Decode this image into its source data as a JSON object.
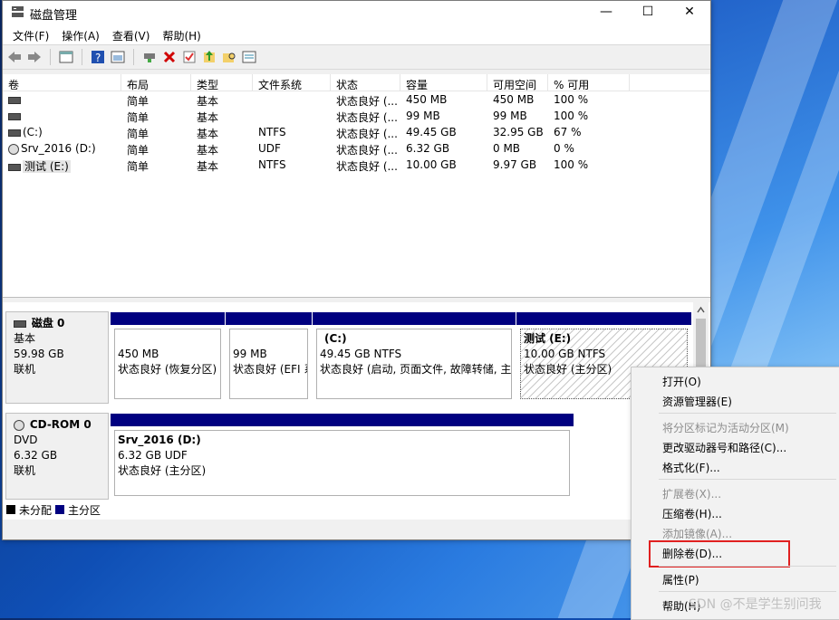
{
  "window": {
    "title": "磁盘管理",
    "min": "—",
    "max": "☐",
    "close": "✕"
  },
  "menu": [
    "文件(F)",
    "操作(A)",
    "查看(V)",
    "帮助(H)"
  ],
  "columns": [
    "卷",
    "布局",
    "类型",
    "文件系统",
    "状态",
    "容量",
    "可用空间",
    "% 可用"
  ],
  "volumes": [
    {
      "icon": "drive",
      "name": "",
      "layout": "简单",
      "type": "基本",
      "fs": "",
      "status": "状态良好 (...",
      "capacity": "450 MB",
      "free": "450 MB",
      "pct": "100 %"
    },
    {
      "icon": "drive",
      "name": "",
      "layout": "简单",
      "type": "基本",
      "fs": "",
      "status": "状态良好 (...",
      "capacity": "99 MB",
      "free": "99 MB",
      "pct": "100 %"
    },
    {
      "icon": "drive",
      "name": "(C:)",
      "layout": "简单",
      "type": "基本",
      "fs": "NTFS",
      "status": "状态良好 (...",
      "capacity": "49.45 GB",
      "free": "32.95 GB",
      "pct": "67 %"
    },
    {
      "icon": "cd",
      "name": "Srv_2016 (D:)",
      "layout": "简单",
      "type": "基本",
      "fs": "UDF",
      "status": "状态良好 (...",
      "capacity": "6.32 GB",
      "free": "0 MB",
      "pct": "0 %"
    },
    {
      "icon": "drive",
      "name": "测试 (E:)",
      "layout": "简单",
      "type": "基本",
      "fs": "NTFS",
      "status": "状态良好 (...",
      "capacity": "10.00 GB",
      "free": "9.97 GB",
      "pct": "100 %"
    }
  ],
  "disk0": {
    "name": "磁盘 0",
    "type": "基本",
    "size": "59.98 GB",
    "state": "联机",
    "partitions": [
      {
        "title": "",
        "size": "450 MB",
        "status": "状态良好 (恢复分区)"
      },
      {
        "title": "",
        "size": "99 MB",
        "status": "状态良好 (EFI 系"
      },
      {
        "title": "(C:)",
        "size": "49.45 GB NTFS",
        "status": "状态良好 (启动, 页面文件, 故障转储, 主"
      },
      {
        "title": "测试  (E:)",
        "size": "10.00 GB NTFS",
        "status": "状态良好 (主分区)"
      }
    ]
  },
  "cdrom0": {
    "name": "CD-ROM 0",
    "type": "DVD",
    "size": "6.32 GB",
    "state": "联机",
    "partition": {
      "title": "Srv_2016  (D:)",
      "size": "6.32 GB UDF",
      "status": "状态良好 (主分区)"
    }
  },
  "legend": {
    "unallocated": "未分配",
    "primary": "主分区",
    "colors": {
      "unallocated": "#000000",
      "primary": "#000080"
    }
  },
  "context_menu": {
    "open": "打开(O)",
    "explorer": "资源管理器(E)",
    "mark_active": "将分区标记为活动分区(M)",
    "change_letter": "更改驱动器号和路径(C)...",
    "format": "格式化(F)...",
    "extend": "扩展卷(X)...",
    "shrink": "压缩卷(H)...",
    "mirror": "添加镜像(A)...",
    "delete": "删除卷(D)...",
    "properties": "属性(P)",
    "help": "帮助(H)"
  },
  "watermark": "SDN @不是学生别问我"
}
